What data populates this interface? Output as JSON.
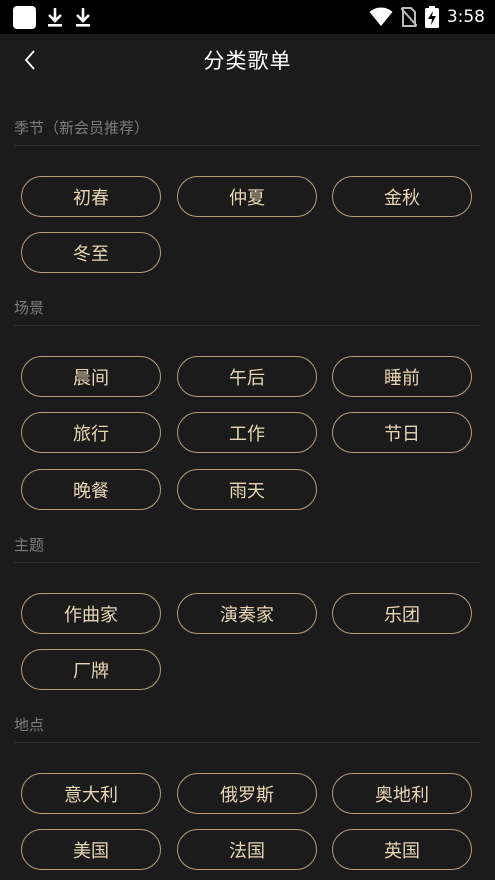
{
  "status_bar": {
    "time": "3:58",
    "icons": [
      "app-square-icon",
      "download-icon",
      "download-icon",
      "wifi-icon",
      "no-sim-icon",
      "battery-charging-icon"
    ]
  },
  "header": {
    "title": "分类歌单",
    "back_icon": "chevron-left-icon"
  },
  "sections": [
    {
      "title": "季节（新会员推荐）",
      "items": [
        "初春",
        "仲夏",
        "金秋",
        "冬至"
      ]
    },
    {
      "title": "场景",
      "items": [
        "晨间",
        "午后",
        "睡前",
        "旅行",
        "工作",
        "节日",
        "晚餐",
        "雨天"
      ]
    },
    {
      "title": "主题",
      "items": [
        "作曲家",
        "演奏家",
        "乐团",
        "厂牌"
      ]
    },
    {
      "title": "地点",
      "items": [
        "意大利",
        "俄罗斯",
        "奥地利",
        "美国",
        "法国",
        "英国"
      ]
    }
  ],
  "colors": {
    "background": "#1b1b1b",
    "chip_border": "#b59d76",
    "chip_text": "#e9d6b5",
    "section_title": "#7d7d7d"
  }
}
